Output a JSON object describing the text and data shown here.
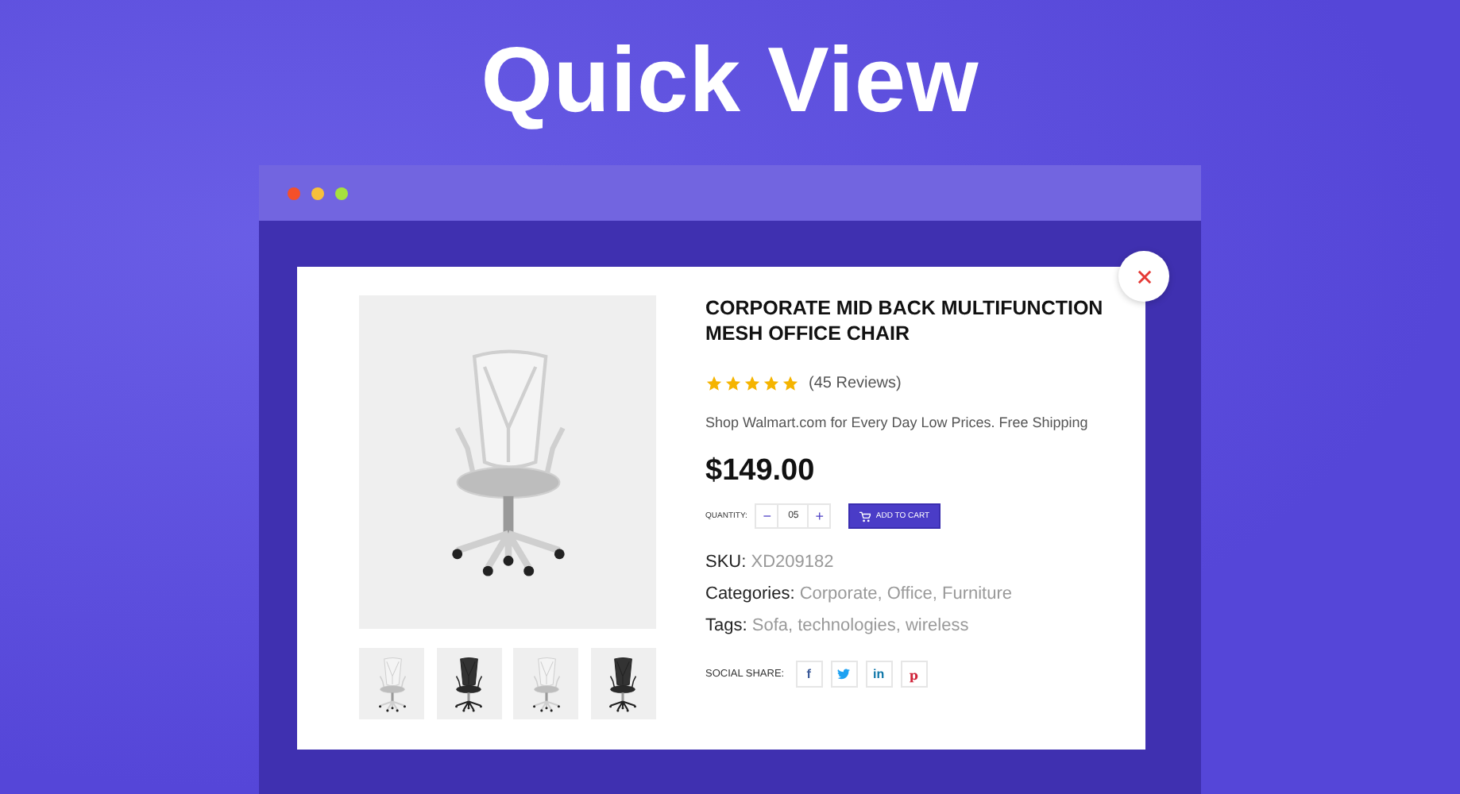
{
  "page_title": "Quick View",
  "product": {
    "title": "CORPORATE MID BACK MULTIFUNCTION MESH OFFICE CHAIR",
    "stars": 5,
    "reviews": "(45 Reviews)",
    "description": "Shop Walmart.com for Every Day Low Prices. Free Shipping",
    "price": "$149.00",
    "quantity_label": "QUANTITY:",
    "minus": "−",
    "quantity": "05",
    "plus": "+",
    "add_to_cart": "ADD TO CART",
    "meta": [
      {
        "label": "SKU:",
        "value": "XD209182"
      },
      {
        "label": "Categories:",
        "value": "Corporate, Office, Furniture"
      },
      {
        "label": "Tags:",
        "value": "Sofa, technologies, wireless"
      }
    ],
    "social_label": "SOCIAL SHARE:",
    "social": [
      {
        "kind": "letter",
        "label": "f",
        "color": "#3b5998"
      },
      {
        "kind": "bird",
        "color": "#1da1f2"
      },
      {
        "kind": "letter",
        "label": "in",
        "color": "#0e76a8"
      },
      {
        "kind": "letter",
        "label": "p",
        "color": "#d0243a"
      }
    ]
  }
}
